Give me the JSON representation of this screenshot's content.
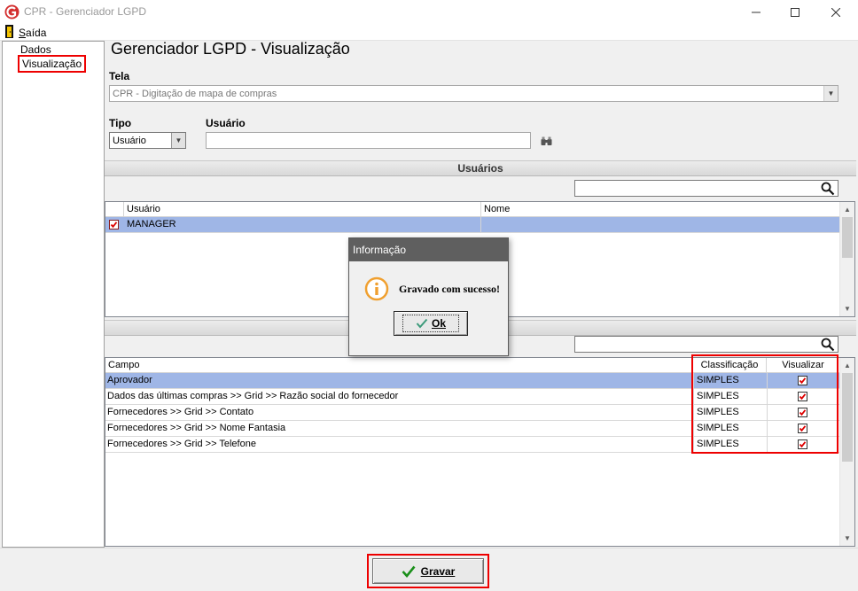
{
  "window": {
    "title": "CPR - Gerenciador LGPD"
  },
  "menu": {
    "exit": "Saída"
  },
  "tree": {
    "items": [
      "Dados",
      "Visualização"
    ]
  },
  "page": {
    "title": "Gerenciador LGPD - Visualização"
  },
  "tela": {
    "label": "Tela",
    "value": "CPR - Digitação de mapa de compras"
  },
  "tipo": {
    "label": "Tipo",
    "value": "Usuário"
  },
  "usuario_field": {
    "label": "Usuário",
    "value": ""
  },
  "users_section": {
    "title": "Usuários",
    "columns": [
      "Usuário",
      "Nome"
    ],
    "rows": [
      {
        "checked": true,
        "usuario": "MANAGER",
        "nome": ""
      }
    ]
  },
  "fields_grid": {
    "columns": [
      "Campo",
      "Classificação",
      "Visualizar"
    ],
    "rows": [
      {
        "campo": "Aprovador",
        "classificacao": "SIMPLES",
        "visualizar": true
      },
      {
        "campo": "Dados das últimas compras >> Grid >> Razão social do fornecedor",
        "classificacao": "SIMPLES",
        "visualizar": true
      },
      {
        "campo": "Fornecedores >> Grid >> Contato",
        "classificacao": "SIMPLES",
        "visualizar": true
      },
      {
        "campo": "Fornecedores >> Grid >> Nome Fantasia",
        "classificacao": "SIMPLES",
        "visualizar": true
      },
      {
        "campo": "Fornecedores >> Grid >> Telefone",
        "classificacao": "SIMPLES",
        "visualizar": true
      }
    ]
  },
  "dialog": {
    "title": "Informação",
    "message": "Gravado com sucesso!",
    "ok_label": "Ok"
  },
  "save": {
    "label": "Gravar"
  },
  "colors": {
    "selection": "#9fb6e6",
    "highlight": "#e00000",
    "accent": "#d32f2f"
  }
}
